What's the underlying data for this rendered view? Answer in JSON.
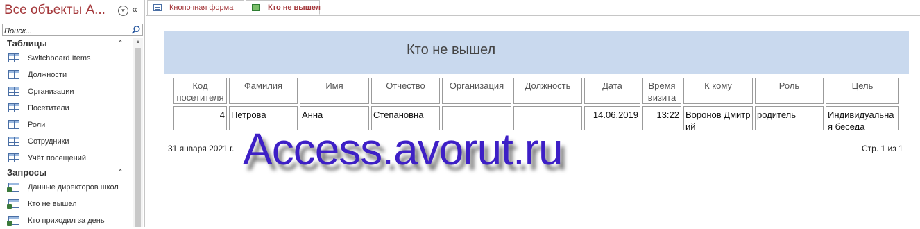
{
  "nav": {
    "title": "Все объекты A...",
    "search_placeholder": "Поиск...",
    "groups": [
      {
        "label": "Таблицы",
        "items": [
          "Switchboard Items",
          "Должности",
          "Организации",
          "Посетители",
          "Роли",
          "Сотрудники",
          "Учёт посещений"
        ]
      },
      {
        "label": "Запросы",
        "items": [
          "Данные директоров школ",
          "Кто не вышел",
          "Кто приходил за день"
        ]
      }
    ]
  },
  "tabs": [
    {
      "label": "Кнопочная форма",
      "icon": "form-icon"
    },
    {
      "label": "Кто не вышел",
      "icon": "report-icon",
      "active": true
    }
  ],
  "report": {
    "title": "Кто не вышел",
    "columns": [
      "Код посетителя",
      "Фамилия",
      "Имя",
      "Отчество",
      "Организация",
      "Должность",
      "Дата",
      "Время визита",
      "К кому",
      "Роль",
      "Цель"
    ],
    "row": {
      "code": "4",
      "surname": "Петрова",
      "name": "Анна",
      "patronymic": "Степановна",
      "organization": "",
      "position": "",
      "date": "14.06.2019",
      "time": "13:22",
      "to_whom": "Воронов Дмитрий",
      "role": "родитель",
      "purpose": "Индивидуальна я беседа"
    },
    "footer_date": "31 января 2021 г.",
    "footer_page": "Стр. 1 из 1"
  },
  "watermark": "Access.avorut.ru",
  "colors": {
    "accent": "#a4373a",
    "report_header_bg": "#c9d9ee",
    "watermark": "#3d1fc6"
  }
}
